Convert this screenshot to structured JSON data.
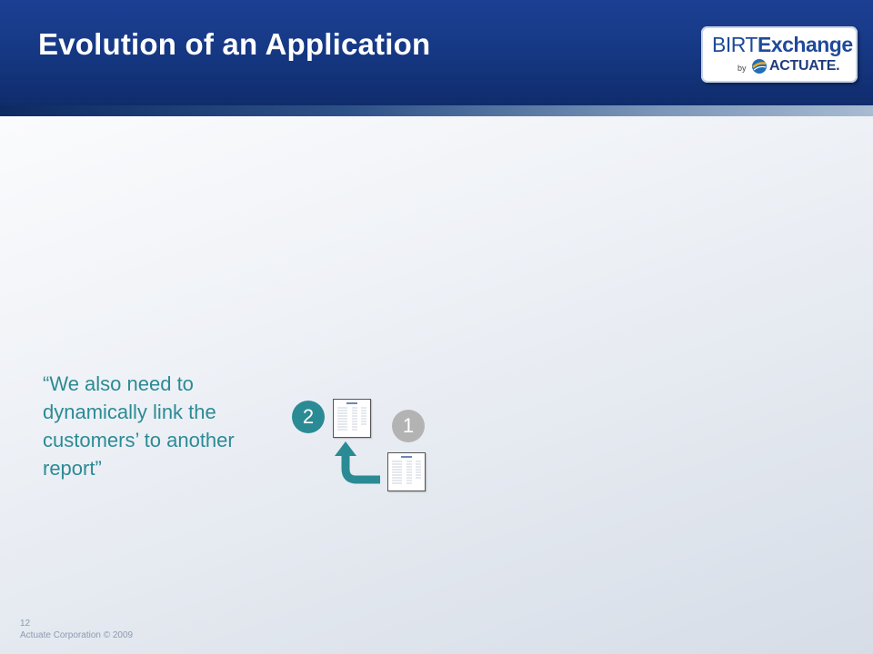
{
  "slide": {
    "title": "Evolution of an Application",
    "quote": "“We also need to dynamically link the customers’ to another report”",
    "number": "12",
    "copyright": "Actuate Corporation © 2009"
  },
  "logo": {
    "birt": "BIRT",
    "exchange": "Exchange",
    "by": "by",
    "actuate": "ACTUATE."
  },
  "diagram": {
    "badge_2": "2",
    "badge_1": "1"
  },
  "colors": {
    "header": "#1a3b8b",
    "accent_teal": "#2a8b94",
    "badge_gray": "#b3b3b3"
  }
}
